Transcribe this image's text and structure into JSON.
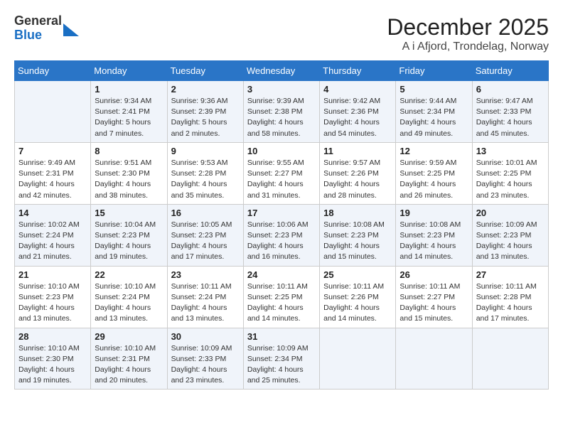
{
  "logo": {
    "general": "General",
    "blue": "Blue"
  },
  "title": "December 2025",
  "subtitle": "A i Afjord, Trondelag, Norway",
  "days_of_week": [
    "Sunday",
    "Monday",
    "Tuesday",
    "Wednesday",
    "Thursday",
    "Friday",
    "Saturday"
  ],
  "weeks": [
    [
      {
        "num": "",
        "info": ""
      },
      {
        "num": "1",
        "info": "Sunrise: 9:34 AM\nSunset: 2:41 PM\nDaylight: 5 hours\nand 7 minutes."
      },
      {
        "num": "2",
        "info": "Sunrise: 9:36 AM\nSunset: 2:39 PM\nDaylight: 5 hours\nand 2 minutes."
      },
      {
        "num": "3",
        "info": "Sunrise: 9:39 AM\nSunset: 2:38 PM\nDaylight: 4 hours\nand 58 minutes."
      },
      {
        "num": "4",
        "info": "Sunrise: 9:42 AM\nSunset: 2:36 PM\nDaylight: 4 hours\nand 54 minutes."
      },
      {
        "num": "5",
        "info": "Sunrise: 9:44 AM\nSunset: 2:34 PM\nDaylight: 4 hours\nand 49 minutes."
      },
      {
        "num": "6",
        "info": "Sunrise: 9:47 AM\nSunset: 2:33 PM\nDaylight: 4 hours\nand 45 minutes."
      }
    ],
    [
      {
        "num": "7",
        "info": "Sunrise: 9:49 AM\nSunset: 2:31 PM\nDaylight: 4 hours\nand 42 minutes."
      },
      {
        "num": "8",
        "info": "Sunrise: 9:51 AM\nSunset: 2:30 PM\nDaylight: 4 hours\nand 38 minutes."
      },
      {
        "num": "9",
        "info": "Sunrise: 9:53 AM\nSunset: 2:28 PM\nDaylight: 4 hours\nand 35 minutes."
      },
      {
        "num": "10",
        "info": "Sunrise: 9:55 AM\nSunset: 2:27 PM\nDaylight: 4 hours\nand 31 minutes."
      },
      {
        "num": "11",
        "info": "Sunrise: 9:57 AM\nSunset: 2:26 PM\nDaylight: 4 hours\nand 28 minutes."
      },
      {
        "num": "12",
        "info": "Sunrise: 9:59 AM\nSunset: 2:25 PM\nDaylight: 4 hours\nand 26 minutes."
      },
      {
        "num": "13",
        "info": "Sunrise: 10:01 AM\nSunset: 2:25 PM\nDaylight: 4 hours\nand 23 minutes."
      }
    ],
    [
      {
        "num": "14",
        "info": "Sunrise: 10:02 AM\nSunset: 2:24 PM\nDaylight: 4 hours\nand 21 minutes."
      },
      {
        "num": "15",
        "info": "Sunrise: 10:04 AM\nSunset: 2:23 PM\nDaylight: 4 hours\nand 19 minutes."
      },
      {
        "num": "16",
        "info": "Sunrise: 10:05 AM\nSunset: 2:23 PM\nDaylight: 4 hours\nand 17 minutes."
      },
      {
        "num": "17",
        "info": "Sunrise: 10:06 AM\nSunset: 2:23 PM\nDaylight: 4 hours\nand 16 minutes."
      },
      {
        "num": "18",
        "info": "Sunrise: 10:08 AM\nSunset: 2:23 PM\nDaylight: 4 hours\nand 15 minutes."
      },
      {
        "num": "19",
        "info": "Sunrise: 10:08 AM\nSunset: 2:23 PM\nDaylight: 4 hours\nand 14 minutes."
      },
      {
        "num": "20",
        "info": "Sunrise: 10:09 AM\nSunset: 2:23 PM\nDaylight: 4 hours\nand 13 minutes."
      }
    ],
    [
      {
        "num": "21",
        "info": "Sunrise: 10:10 AM\nSunset: 2:23 PM\nDaylight: 4 hours\nand 13 minutes."
      },
      {
        "num": "22",
        "info": "Sunrise: 10:10 AM\nSunset: 2:24 PM\nDaylight: 4 hours\nand 13 minutes."
      },
      {
        "num": "23",
        "info": "Sunrise: 10:11 AM\nSunset: 2:24 PM\nDaylight: 4 hours\nand 13 minutes."
      },
      {
        "num": "24",
        "info": "Sunrise: 10:11 AM\nSunset: 2:25 PM\nDaylight: 4 hours\nand 14 minutes."
      },
      {
        "num": "25",
        "info": "Sunrise: 10:11 AM\nSunset: 2:26 PM\nDaylight: 4 hours\nand 14 minutes."
      },
      {
        "num": "26",
        "info": "Sunrise: 10:11 AM\nSunset: 2:27 PM\nDaylight: 4 hours\nand 15 minutes."
      },
      {
        "num": "27",
        "info": "Sunrise: 10:11 AM\nSunset: 2:28 PM\nDaylight: 4 hours\nand 17 minutes."
      }
    ],
    [
      {
        "num": "28",
        "info": "Sunrise: 10:10 AM\nSunset: 2:30 PM\nDaylight: 4 hours\nand 19 minutes."
      },
      {
        "num": "29",
        "info": "Sunrise: 10:10 AM\nSunset: 2:31 PM\nDaylight: 4 hours\nand 20 minutes."
      },
      {
        "num": "30",
        "info": "Sunrise: 10:09 AM\nSunset: 2:33 PM\nDaylight: 4 hours\nand 23 minutes."
      },
      {
        "num": "31",
        "info": "Sunrise: 10:09 AM\nSunset: 2:34 PM\nDaylight: 4 hours\nand 25 minutes."
      },
      {
        "num": "",
        "info": ""
      },
      {
        "num": "",
        "info": ""
      },
      {
        "num": "",
        "info": ""
      }
    ]
  ]
}
